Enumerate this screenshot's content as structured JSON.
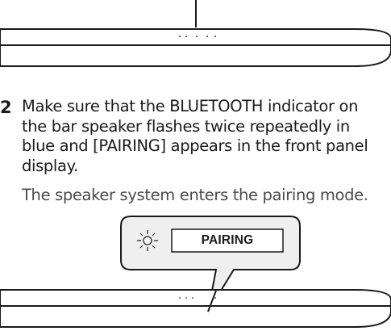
{
  "step": {
    "number": "2",
    "instruction": "Make sure that the BLUETOOTH indicator on\nthe bar speaker flashes twice repeatedly in\nblue and [PAIRING] appears in the front panel\ndisplay.",
    "result": "The speaker system enters the pairing mode."
  },
  "callout": {
    "display_text": "PAIRING",
    "indicator_icon": "blinking-light-icon"
  },
  "colors": {
    "line": "#1a1a1a",
    "callout_fill": "#efefef",
    "bar_shade": "#d9d9d9"
  }
}
